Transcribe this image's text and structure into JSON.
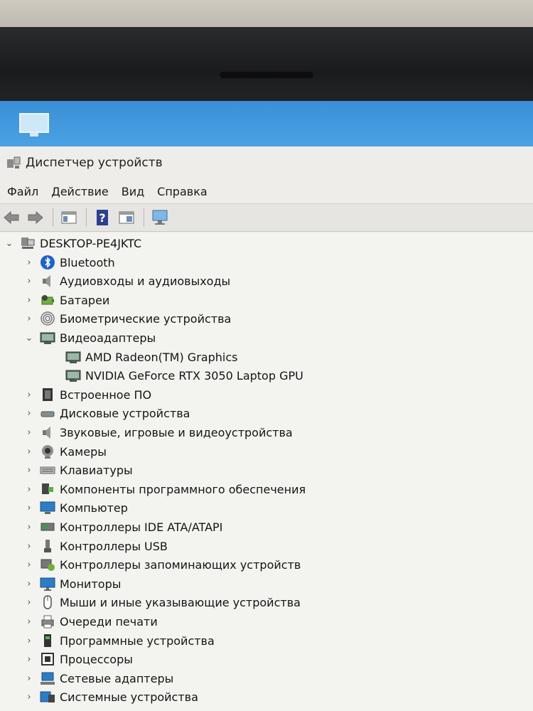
{
  "window": {
    "title": "Диспетчер устройств"
  },
  "menu": [
    "Файл",
    "Действие",
    "Вид",
    "Справка"
  ],
  "toolbar": [
    "back-icon",
    "forward-icon",
    "console-tree-icon",
    "help-icon",
    "properties-icon",
    "scan-hardware-icon"
  ],
  "tree": {
    "root": "DESKTOP-PE4JKTC",
    "categories": [
      {
        "label": "Bluetooth",
        "icon": "bluetooth-icon",
        "expanded": false
      },
      {
        "label": "Аудиовходы и аудиовыходы",
        "icon": "speaker-icon",
        "expanded": false
      },
      {
        "label": "Батареи",
        "icon": "battery-icon",
        "expanded": false
      },
      {
        "label": "Биометрические устройства",
        "icon": "fingerprint-icon",
        "expanded": false
      },
      {
        "label": "Видеоадаптеры",
        "icon": "display-adapter-icon",
        "expanded": true,
        "children": [
          {
            "label": "AMD Radeon(TM) Graphics",
            "icon": "display-adapter-icon"
          },
          {
            "label": "NVIDIA GeForce RTX 3050 Laptop GPU",
            "icon": "display-adapter-icon"
          }
        ]
      },
      {
        "label": "Встроенное ПО",
        "icon": "firmware-icon",
        "expanded": false
      },
      {
        "label": "Дисковые устройства",
        "icon": "disk-drive-icon",
        "expanded": false
      },
      {
        "label": "Звуковые, игровые и видеоустройства",
        "icon": "speaker-icon",
        "expanded": false
      },
      {
        "label": "Камеры",
        "icon": "camera-icon",
        "expanded": false
      },
      {
        "label": "Клавиатуры",
        "icon": "keyboard-icon",
        "expanded": false
      },
      {
        "label": "Компоненты программного обеспечения",
        "icon": "software-component-icon",
        "expanded": false
      },
      {
        "label": "Компьютер",
        "icon": "computer-icon",
        "expanded": false
      },
      {
        "label": "Контроллеры IDE ATA/ATAPI",
        "icon": "ide-controller-icon",
        "expanded": false
      },
      {
        "label": "Контроллеры USB",
        "icon": "usb-icon",
        "expanded": false
      },
      {
        "label": "Контроллеры запоминающих устройств",
        "icon": "storage-controller-icon",
        "expanded": false
      },
      {
        "label": "Мониторы",
        "icon": "monitor-icon",
        "expanded": false
      },
      {
        "label": "Мыши и иные указывающие устройства",
        "icon": "mouse-icon",
        "expanded": false
      },
      {
        "label": "Очереди печати",
        "icon": "printer-icon",
        "expanded": false
      },
      {
        "label": "Программные устройства",
        "icon": "software-device-icon",
        "expanded": false
      },
      {
        "label": "Процессоры",
        "icon": "processor-icon",
        "expanded": false
      },
      {
        "label": "Сетевые адаптеры",
        "icon": "network-adapter-icon",
        "expanded": false
      },
      {
        "label": "Системные устройства",
        "icon": "system-devices-icon",
        "expanded": false
      }
    ]
  }
}
